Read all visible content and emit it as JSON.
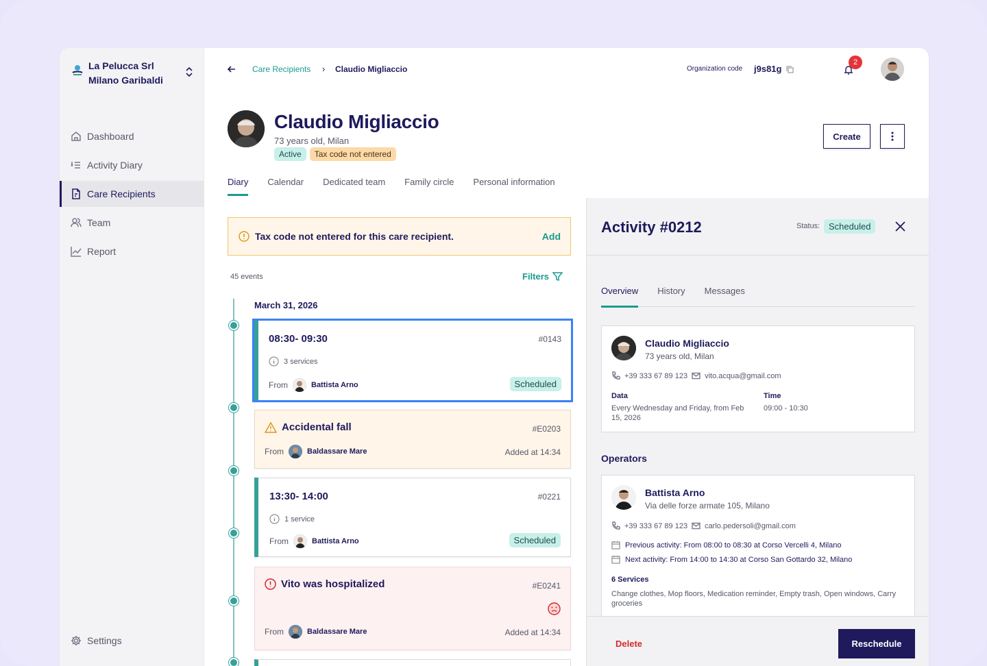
{
  "org": {
    "line1": "La Pelucca Srl",
    "line2": "Milano Garibaldi"
  },
  "nav": {
    "items": [
      {
        "label": "Dashboard",
        "icon": "home-icon"
      },
      {
        "label": "Activity Diary",
        "icon": "list-icon"
      },
      {
        "label": "Care Recipients",
        "icon": "document-icon",
        "active": true
      },
      {
        "label": "Team",
        "icon": "users-icon"
      },
      {
        "label": "Report",
        "icon": "chart-icon"
      }
    ],
    "settings": "Settings"
  },
  "breadcrumb": {
    "parent": "Care Recipients",
    "sep": "›",
    "current": "Claudio Migliaccio"
  },
  "top": {
    "org_code_label": "Organization code",
    "org_code": "j9s81g",
    "notifications": "2"
  },
  "profile": {
    "name": "Claudio Migliaccio",
    "sub": "73 years old, Milan",
    "badges": [
      "Active",
      "Tax code not entered"
    ],
    "create": "Create"
  },
  "tabs": [
    "Diary",
    "Calendar",
    "Dedicated team",
    "Family circle",
    "Personal information"
  ],
  "alert": {
    "text": "Tax code not entered for this care recipient.",
    "action": "Add"
  },
  "diary": {
    "count": "45 events",
    "filters": "Filters",
    "date": "March 31, 2026",
    "cards": [
      {
        "time": "08:30- 09:30",
        "id": "#0143",
        "services": "3 services",
        "from_label": "From",
        "from": "Battista Arno",
        "status": "Scheduled"
      },
      {
        "title": "Accidental fall",
        "id": "#E0203",
        "from_label": "From",
        "from": "Baldassare Mare",
        "added": "Added at 14:34"
      },
      {
        "time": "13:30- 14:00",
        "id": "#0221",
        "services": "1 service",
        "from_label": "From",
        "from": "Battista Arno",
        "status": "Scheduled"
      },
      {
        "title": "Vito was hospitalized",
        "id": "#E0241",
        "from_label": "From",
        "from": "Baldassare Mare",
        "added": "Added at 14:34"
      }
    ]
  },
  "panel": {
    "title": "Activity #0212",
    "status_label": "Status:",
    "status": "Scheduled",
    "tabs": [
      "Overview",
      "History",
      "Messages"
    ],
    "recipient": {
      "name": "Claudio Migliaccio",
      "sub": "73 years old, Milan",
      "phone": "+39 333 67 89 123",
      "email": "vito.acqua@gmail.com",
      "data_label": "Data",
      "data_value": "Every Wednesday and Friday, from Feb 15, 2026",
      "time_label": "Time",
      "time_value": "09:00 - 10:30"
    },
    "operators_title": "Operators",
    "operator": {
      "name": "Battista Arno",
      "address": "Via delle forze armate 105, Milano",
      "phone": "+39 333 67 89 123",
      "email": "carlo.pedersoli@gmail.com",
      "prev_label": "Previous activity:",
      "prev": "From 08:00 to 08:30 at Corso Vercelli 4, Milano",
      "next_label": "Next activity:",
      "next": "From 14:00 to 14:30 at Corso San Gottardo 32, Milano",
      "services_label": "6 Services",
      "services": "Change clothes, Mop floors, Medication reminder, Empty trash, Open windows, Carry groceries"
    },
    "delete": "Delete",
    "reschedule": "Reschedule"
  },
  "colors": {
    "primary": "#1e1a5c",
    "teal": "#1a9a8f",
    "danger": "#d42a2a",
    "warning_bg": "#fff6e9"
  }
}
